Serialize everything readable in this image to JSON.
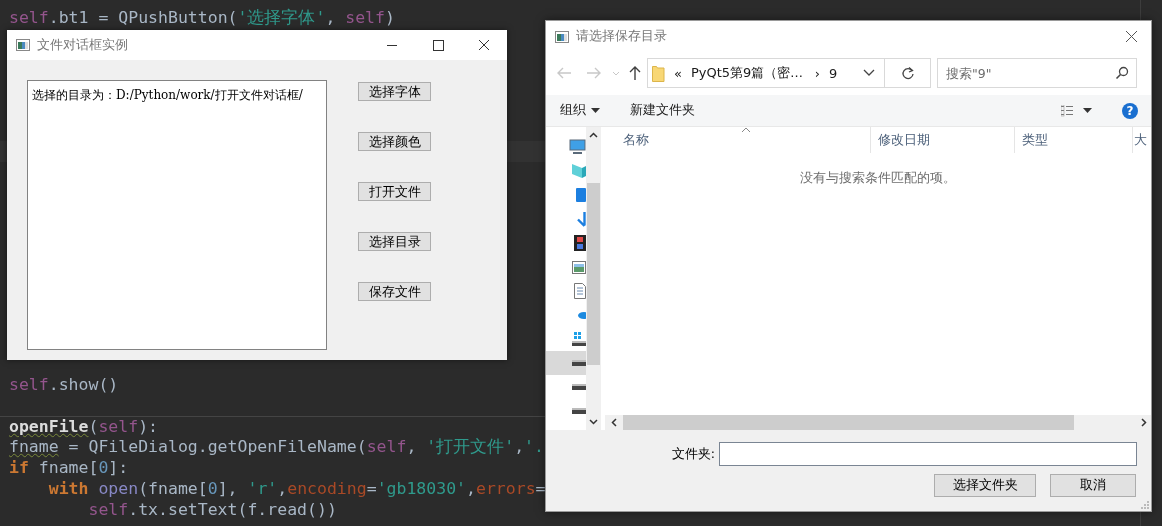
{
  "editor": {
    "top_lines": [
      {
        "tokens": [
          {
            "text": "self",
            "kind": "self"
          },
          {
            "text": ".bt1 = QPushButton(",
            "kind": "plain"
          },
          {
            "text": "'选择字体'",
            "kind": "string"
          },
          {
            "text": ", ",
            "kind": "plain"
          },
          {
            "text": "self",
            "kind": "self"
          },
          {
            "text": ")",
            "kind": "plain"
          }
        ]
      }
    ],
    "bottom_lines": [
      {
        "tokens": [
          {
            "text": "self",
            "kind": "self"
          },
          {
            "text": ".show()",
            "kind": "plain"
          }
        ]
      },
      {
        "separator_before": true,
        "tokens": [
          {
            "text": "openFile",
            "kind": "funcname",
            "warning": true
          },
          {
            "text": "(",
            "kind": "plain"
          },
          {
            "text": "self",
            "kind": "self"
          },
          {
            "text": "):",
            "kind": "plain"
          }
        ]
      },
      {
        "tokens": [
          {
            "text": "fname",
            "kind": "plain",
            "warning": true
          },
          {
            "text": " = QFileDialog.getOpenFileName(",
            "kind": "plain"
          },
          {
            "text": "self",
            "kind": "self"
          },
          {
            "text": ", ",
            "kind": "plain"
          },
          {
            "text": "'打开文件'",
            "kind": "string"
          },
          {
            "text": ",",
            "kind": "plain"
          },
          {
            "text": "'.",
            "kind": "string"
          }
        ]
      },
      {
        "tokens": [
          {
            "text": "if",
            "kind": "keyword"
          },
          {
            "text": " fname[",
            "kind": "plain"
          },
          {
            "text": "0",
            "kind": "number"
          },
          {
            "text": "]:",
            "kind": "plain"
          }
        ],
        "children": [
          {
            "tokens": [
              {
                "text": "with ",
                "kind": "keyword"
              },
              {
                "text": "open",
                "kind": "builtin"
              },
              {
                "text": "(fname[",
                "kind": "plain"
              },
              {
                "text": "0",
                "kind": "number"
              },
              {
                "text": "], ",
                "kind": "plain"
              },
              {
                "text": "'r'",
                "kind": "string"
              },
              {
                "text": ",",
                "kind": "plain"
              },
              {
                "text": "encoding",
                "kind": "param"
              },
              {
                "text": "=",
                "kind": "plain"
              },
              {
                "text": "'gb18030'",
                "kind": "string"
              },
              {
                "text": ",",
                "kind": "plain"
              },
              {
                "text": "errors",
                "kind": "param"
              },
              {
                "text": "=",
                "kind": "plain"
              }
            ],
            "children": [
              {
                "tokens": [
                  {
                    "text": "self",
                    "kind": "self"
                  },
                  {
                    "text": ".tx.setText(f.read())",
                    "kind": "plain"
                  }
                ]
              }
            ]
          }
        ]
      }
    ]
  },
  "main_window": {
    "title": "文件对话框实例",
    "text": "选择的目录为：D:/Python/work/打开文件对话框/",
    "buttons": [
      "选择字体",
      "选择颜色",
      "打开文件",
      "选择目录",
      "保存文件"
    ]
  },
  "dialog": {
    "title": "请选择保存目录",
    "back": {
      "disabled": true
    },
    "forward": {
      "disabled": true
    },
    "up": {
      "disabled": false
    },
    "address": {
      "overflow": "«",
      "crumbs": [
        "PyQt5第9篇（密...",
        "9"
      ],
      "separator": "›"
    },
    "search": {
      "placeholder": "搜索\"9\""
    },
    "toolbar": {
      "organize": "组织",
      "new_folder": "新建文件夹",
      "help": "?"
    },
    "nav_items": [
      {
        "kind": "computer",
        "selected": false
      },
      {
        "kind": "cube",
        "selected": false
      },
      {
        "kind": "tablet",
        "selected": false
      },
      {
        "kind": "download",
        "selected": false
      },
      {
        "kind": "film",
        "selected": false
      },
      {
        "kind": "picture",
        "selected": false
      },
      {
        "kind": "document",
        "selected": false
      },
      {
        "kind": "cloud",
        "selected": false
      },
      {
        "kind": "system_drive",
        "selected": false
      },
      {
        "kind": "drive",
        "selected": true
      },
      {
        "kind": "drive",
        "selected": false
      },
      {
        "kind": "drive",
        "selected": false
      }
    ],
    "columns": [
      {
        "label": "名称",
        "sorted": true
      },
      {
        "label": "修改日期",
        "sorted": false
      },
      {
        "label": "类型",
        "sorted": false
      },
      {
        "label": "大",
        "sorted": false
      }
    ],
    "empty_message": "没有与搜索条件匹配的项。",
    "folder_label": "文件夹:",
    "buttons": [
      "选择文件夹",
      "取消"
    ]
  }
}
